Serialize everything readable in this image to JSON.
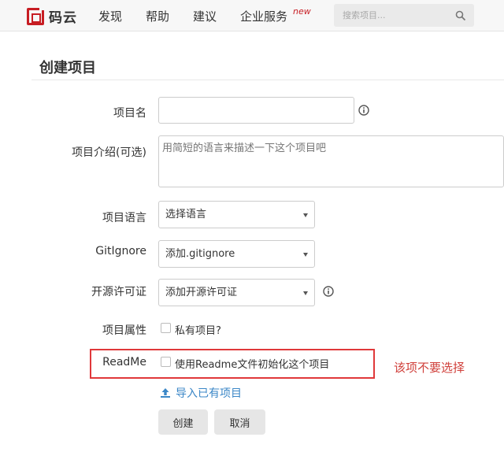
{
  "nav": {
    "logo_text": "码云",
    "items": [
      "发现",
      "帮助",
      "建议",
      "企业服务"
    ],
    "new_badge": "new",
    "search_placeholder": "搜索项目..."
  },
  "page": {
    "title": "创建项目"
  },
  "form": {
    "name_label": "项目名",
    "name_value": "",
    "desc_label": "项目介绍(可选)",
    "desc_placeholder": "用简短的语言来描述一下这个项目吧",
    "lang_label": "项目语言",
    "lang_value": "选择语言",
    "gitignore_label": "GitIgnore",
    "gitignore_value": "添加.gitignore",
    "license_label": "开源许可证",
    "license_value": "添加开源许可证",
    "attr_label": "项目属性",
    "private_label": "私有项目?",
    "readme_label": "ReadMe",
    "readme_checkbox_label": "使用Readme文件初始化这个项目",
    "import_link": "导入已有项目",
    "create_button": "创建",
    "cancel_button": "取消"
  },
  "annotation": {
    "text": "该项不要选择",
    "color": "#d0403b"
  },
  "colors": {
    "brand": "#c71d23",
    "link": "#3b87c7",
    "highlight_border": "#e0383a"
  },
  "icons": {
    "search": "search-icon",
    "info": "info-icon",
    "upload": "upload-icon"
  }
}
